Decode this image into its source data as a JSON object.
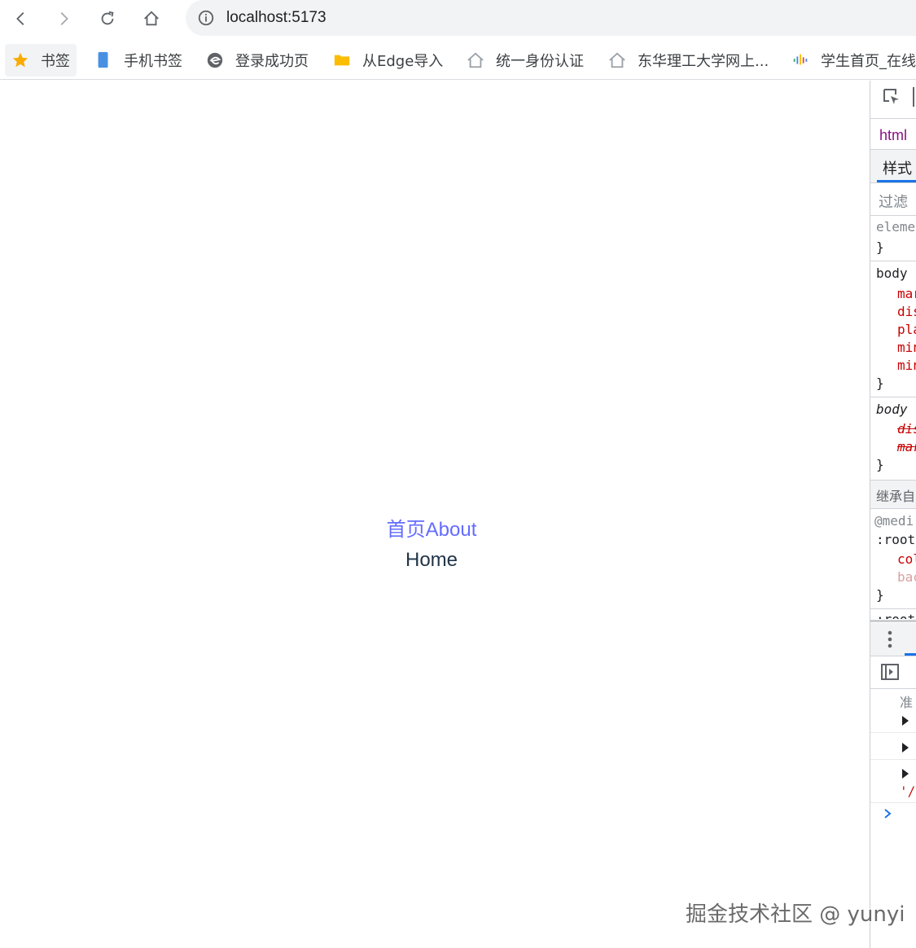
{
  "browser": {
    "url": "localhost:5173",
    "bookmarks": [
      {
        "label": "书签",
        "icon": "star-icon"
      },
      {
        "label": "手机书签",
        "icon": "phone-icon"
      },
      {
        "label": "登录成功页",
        "icon": "edge-icon"
      },
      {
        "label": "从Edge导入",
        "icon": "folder-icon"
      },
      {
        "label": "统一身份认证",
        "icon": "home-icon"
      },
      {
        "label": "东华理工大学网上...",
        "icon": "home-icon"
      },
      {
        "label": "学生首页_在线",
        "icon": "audio-icon"
      }
    ]
  },
  "app": {
    "nav_home": "首页",
    "nav_about": "About",
    "title": "Home"
  },
  "devtools": {
    "breadcrumb": "html",
    "styles_tab": "样式",
    "filter_placeholder": "过滤",
    "rules": {
      "element": "eleme",
      "close1": "}",
      "body1": "body",
      "p1": "mar",
      "p2": "dis",
      "p3": "pla",
      "p4": "min",
      "p5": "min",
      "close2": "}",
      "body2": "body",
      "p6": "dis",
      "p7": "mar",
      "close3": "}",
      "inherited": "继承自",
      "media": "@medi",
      "root": ":root",
      "p8": "col",
      "p9": "bac",
      "close4": "}",
      "root2": ":root"
    },
    "console": {
      "prep": "准",
      "quote": "'/"
    }
  },
  "watermark": "掘金技术社区 @ yunyi",
  "colors": {
    "link": "#646cff",
    "heading": "#213547",
    "prop_red": "#c80000"
  }
}
